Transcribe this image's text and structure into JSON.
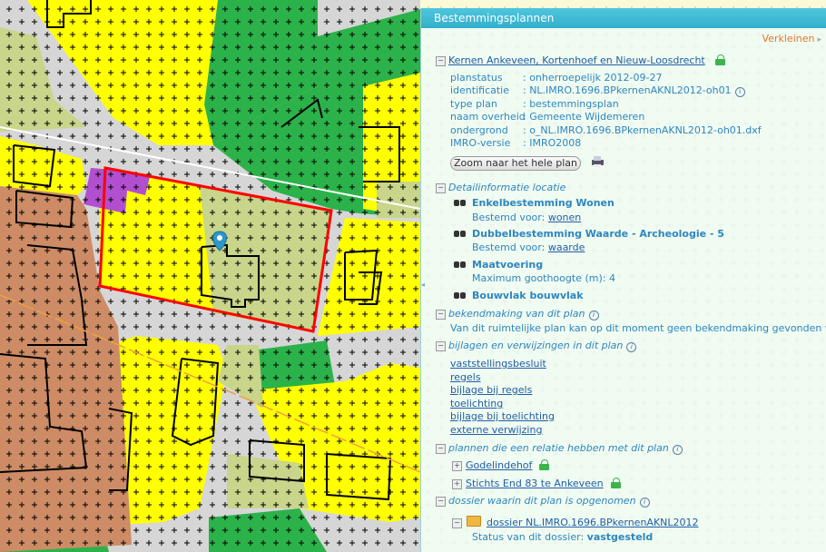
{
  "panel": {
    "title": "Bestemmingsplannen",
    "verkleinen": "Verkleinen",
    "plan": {
      "name": "Kernen Ankeveen, Kortenhoef en Nieuw-Loosdrecht",
      "fields": [
        {
          "key": "planstatus",
          "value": ": onherroepelijk 2012-09-27"
        },
        {
          "key": "identificatie",
          "value": ": NL.IMRO.1696.BPkernenAKNL2012-oh01"
        },
        {
          "key": "type plan",
          "value": ": bestemmingsplan"
        },
        {
          "key": "naam overheid",
          "value": ": Gemeente Wijdemeren"
        },
        {
          "key": "ondergrond",
          "value": ": o_NL.IMRO.1696.BPkernenAKNL2012-oh01.dxf"
        },
        {
          "key": "IMRO-versie",
          "value": ": IMRO2008"
        }
      ],
      "zoom_button": "Zoom naar het hele plan"
    },
    "detail": {
      "title": "Detailinformatie locatie",
      "item1_title": "Enkelbestemming Wonen",
      "item1_sub_prefix": "Bestemd voor: ",
      "item1_sub_link": "wonen",
      "item2_title": "Dubbelbestemming Waarde - Archeologie - 5",
      "item2_sub_prefix": "Bestemd voor: ",
      "item2_sub_link": "waarde",
      "item3_title": "Maatvoering",
      "item3_sub": "Maximum goothoogte (m): 4",
      "item4_title": "Bouwvlak bouwvlak"
    },
    "bekendmaking": {
      "title": "bekendmaking van dit plan",
      "text": "Van dit ruimtelijke plan kan op dit moment geen bekendmaking gevonden worden"
    },
    "bijlagen": {
      "title": "bijlagen en verwijzingen in dit plan",
      "links": [
        "vaststellingsbesluit",
        "regels",
        "bijlage bij regels",
        "toelichting",
        "bijlage bij toelichting",
        "externe verwijzing"
      ]
    },
    "relaties": {
      "title": "plannen die een relatie hebben met dit plan",
      "items": [
        "Godelindehof",
        "Stichts End 83 te Ankeveen"
      ]
    },
    "dossier": {
      "title": "dossier waarin dit plan is opgenomen",
      "link": "dossier NL.IMRO.1696.BPkernenAKNL2012",
      "status_prefix": "Status van dit dossier: ",
      "status_value": "vastgesteld"
    }
  },
  "colors": {
    "header": "#3fb8d1",
    "yellow": "#ffff00",
    "green": "#2db34a",
    "olive": "#c8d58a",
    "brown": "#cc8c64",
    "purple": "#b14fcf",
    "red_outline": "#ff0000",
    "marker": "#2f97c8"
  }
}
